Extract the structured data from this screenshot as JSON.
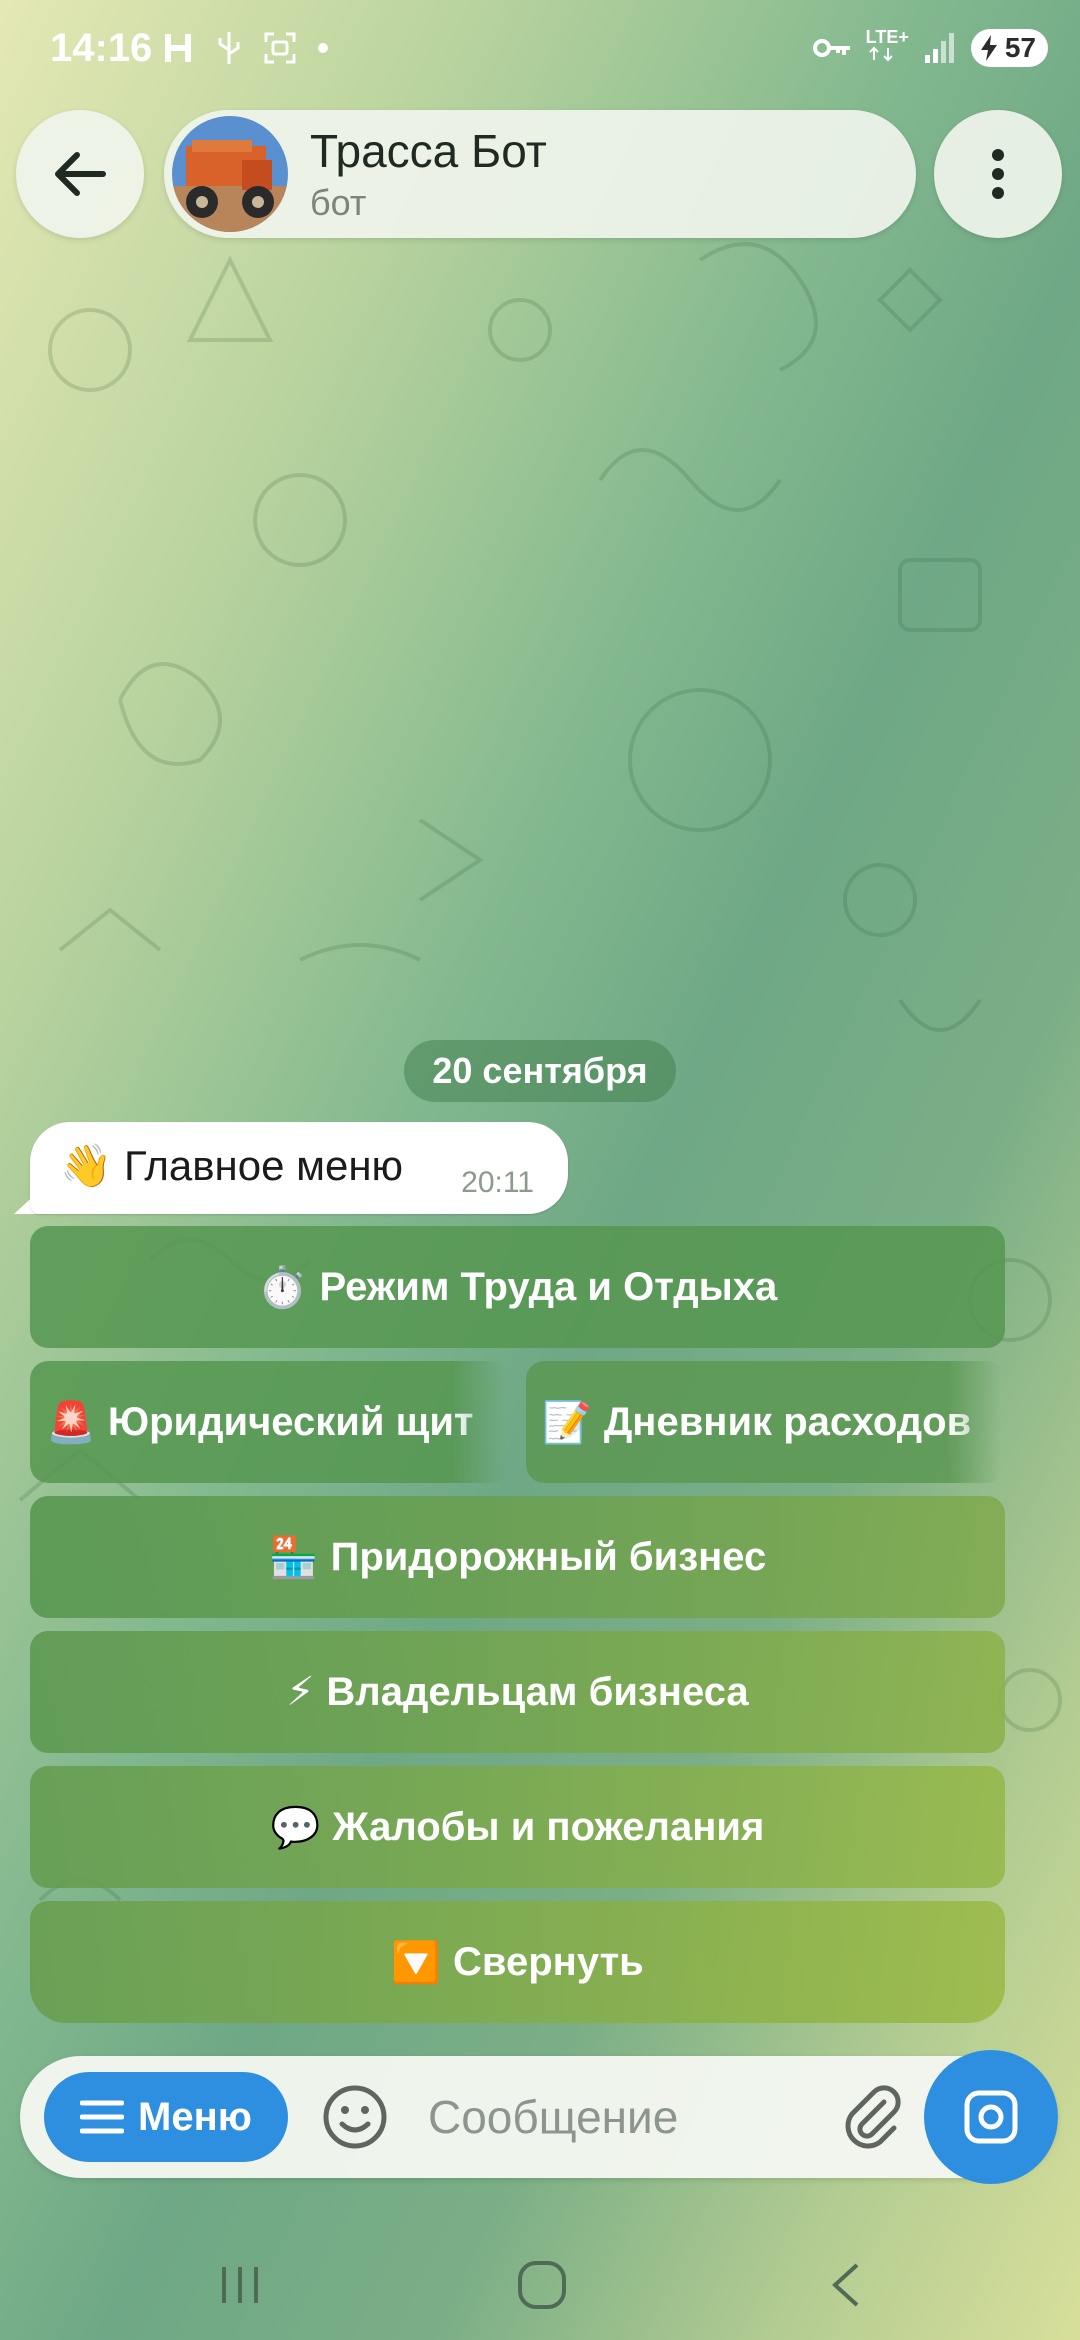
{
  "status_bar": {
    "time": "14:16",
    "network_label": "LTE+",
    "battery_level": "57"
  },
  "header": {
    "title": "Трасса Бот",
    "subtitle": "бот",
    "back_icon": "arrow-left-icon",
    "more_icon": "vertical-dots-icon"
  },
  "chat": {
    "date_label": "20 сентября",
    "message": {
      "emoji": "👋",
      "text": "Главное меню",
      "time": "20:11"
    }
  },
  "keyboard": {
    "rows": [
      [
        {
          "emoji": "⏱️",
          "label": "Режим Труда и Отдыха"
        }
      ],
      [
        {
          "emoji": "🚨",
          "label": "Юридический щит"
        },
        {
          "emoji": "📝",
          "label": "Дневник расходов"
        }
      ],
      [
        {
          "emoji": "🏪",
          "label": "Придорожный бизнес"
        }
      ],
      [
        {
          "emoji": "⚡",
          "label": "Владельцам бизнеса"
        }
      ],
      [
        {
          "emoji": "💬",
          "label": "Жалобы и пожелания"
        }
      ],
      [
        {
          "emoji": "🔽",
          "label": "Свернуть"
        }
      ]
    ]
  },
  "input_bar": {
    "menu_label": "Меню",
    "placeholder": "Сообщение",
    "emoji_icon": "smiley-icon",
    "attach_icon": "paperclip-icon",
    "camera_icon": "camera-icon"
  },
  "colors": {
    "accent_blue": "#2e8fe0",
    "keyboard_button": "#4e9446",
    "date_pill": "#468250"
  }
}
